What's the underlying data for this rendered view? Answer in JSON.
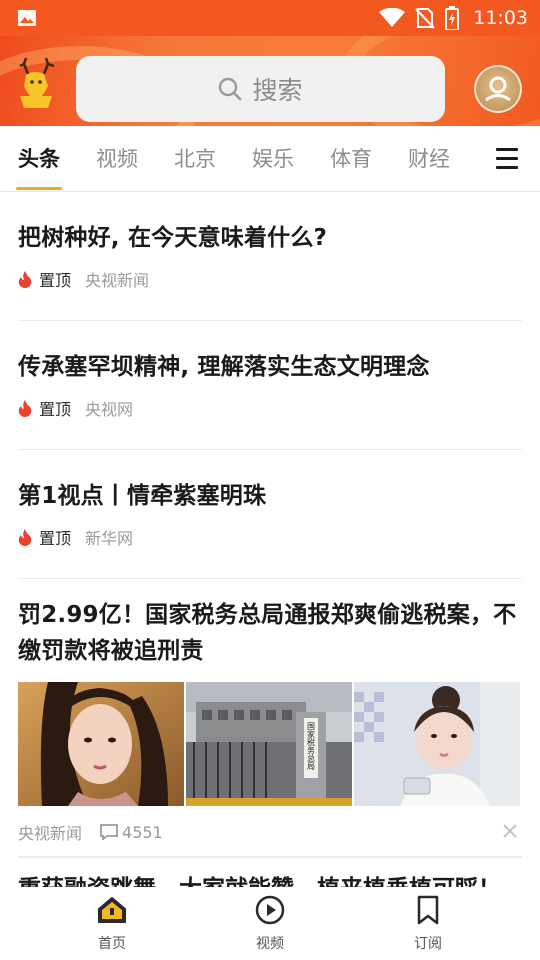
{
  "status_bar": {
    "time": "11:03"
  },
  "search": {
    "placeholder": "搜索"
  },
  "tabs": [
    {
      "label": "头条",
      "active": true
    },
    {
      "label": "视频"
    },
    {
      "label": "北京"
    },
    {
      "label": "娱乐"
    },
    {
      "label": "体育"
    },
    {
      "label": "财经"
    }
  ],
  "feed": [
    {
      "title": "把树种好, 在今天意味着什么?",
      "tag": "置顶",
      "source": "央视新闻"
    },
    {
      "title": "传承塞罕坝精神, 理解落实生态文明理念",
      "tag": "置顶",
      "source": "央视网"
    },
    {
      "title": "第1视点丨情牵紫塞明珠",
      "tag": "置顶",
      "source": "新华网"
    }
  ],
  "multi_item": {
    "title_line1": "罚2.99亿！国家税务总局通报郑爽偷逃税案，不",
    "title_line2": "缴罚款将被追刑责",
    "source": "央视新闻",
    "comments": "4551",
    "sign_text": "国家税务总局"
  },
  "cutoff_title": "重获融资跳舞，大家就能赞，植来植垂植可睬！",
  "bottom_nav": [
    {
      "label": "首页",
      "icon": "home-icon"
    },
    {
      "label": "视频",
      "icon": "video-icon"
    },
    {
      "label": "订阅",
      "icon": "bookmark-icon"
    }
  ],
  "colors": {
    "header": "#f2581f",
    "accent": "#f5a623",
    "fire": "#e8432f"
  }
}
